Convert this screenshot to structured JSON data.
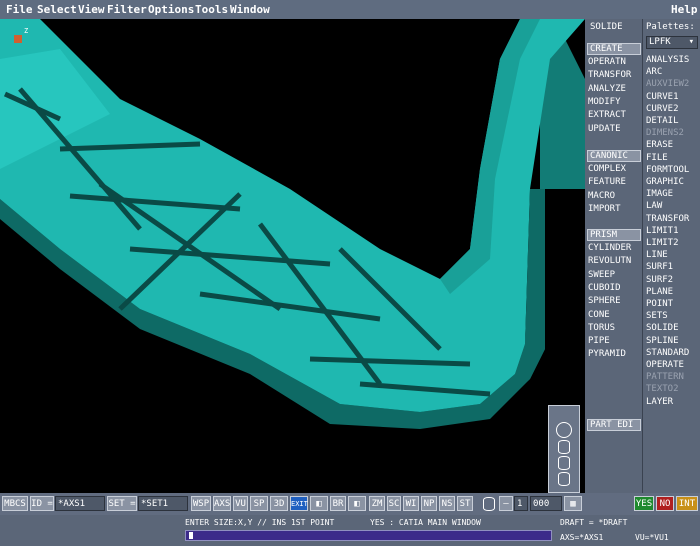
{
  "menubar": {
    "file": "File",
    "select": "Select",
    "view": "View",
    "filter": "Filter",
    "options": "Options",
    "tools": "Tools",
    "window": "Window",
    "help": "Help"
  },
  "panel": {
    "solide_title": "SOLIDE",
    "palettes_title": "Palettes:",
    "palette_select": "LPFK",
    "create_header": "CREATE",
    "create_items": [
      "OPERATN",
      "TRANSFOR",
      "ANALYZE",
      "MODIFY",
      "EXTRACT",
      "UPDATE"
    ],
    "canonic_header": "CANONIC",
    "canonic_items": [
      "COMPLEX",
      "FEATURE",
      "MACRO",
      "IMPORT"
    ],
    "prism_header": "PRISM",
    "prism_items": [
      "CYLINDER",
      "REVOLUTN",
      "SWEEP",
      "CUBOID",
      "SPHERE",
      "CONE",
      "TORUS",
      "PIPE",
      "PYRAMID"
    ],
    "part_edit": "PART EDI",
    "palette_items": [
      "ANALYSIS",
      "ARC",
      "AUXVIEW2",
      "CURVE1",
      "CURVE2",
      "DETAIL",
      "DIMENS2",
      "ERASE",
      "FILE",
      "FORMTOOL",
      "GRAPHIC",
      "IMAGE",
      "LAW",
      "TRANSFOR",
      "LIMIT1",
      "LIMIT2",
      "LINE",
      "SURF1",
      "SURF2",
      "PLANE",
      "POINT",
      "SETS",
      "SOLIDE",
      "SPLINE",
      "STANDARD",
      "OPERATE",
      "PATTERN",
      "TEXTO2",
      "LAYER"
    ],
    "palette_dimmed": [
      false,
      false,
      true,
      false,
      false,
      false,
      true,
      false,
      false,
      false,
      false,
      false,
      false,
      false,
      false,
      false,
      false,
      false,
      false,
      false,
      false,
      false,
      false,
      false,
      false,
      false,
      true,
      true,
      false
    ]
  },
  "toolbar": {
    "mbcs": "MBCS",
    "id_label": "ID =",
    "id_value": "*AXS1",
    "set_label": "SET =",
    "set_value": "*SET1",
    "buttons": [
      "WSP",
      "AXS",
      "VU",
      "SP",
      "3D",
      "EXIT",
      "",
      "BR",
      "",
      "ZM",
      "SC",
      "WI",
      "NP",
      "NS",
      "ST"
    ],
    "counter_a": "1",
    "counter_b": "000",
    "yes": "YES",
    "no": "NO",
    "int": "INT"
  },
  "status": {
    "prompt": "ENTER SIZE:X,Y // INS 1ST POINT",
    "window_msg": "YES : CATIA MAIN WINDOW",
    "draft": "DRAFT = *DRAFT",
    "axs": "AXS=*AXS1",
    "vu": "VU=*VU1"
  },
  "viewport": {
    "axis_label": "Z"
  },
  "colors": {
    "part_top": "#1fb8b0",
    "part_side": "#127c76",
    "part_dark": "#0a4a46",
    "bg": "#000000"
  }
}
